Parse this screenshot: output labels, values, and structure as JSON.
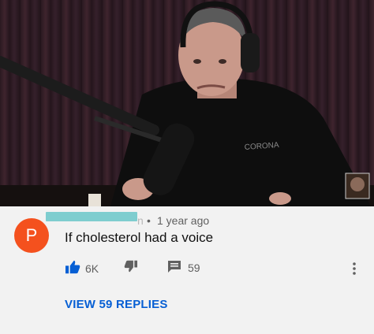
{
  "video": {
    "scene": "podcast-guest-at-microphone",
    "shirt_logo": "CORONA"
  },
  "comment": {
    "avatar_letter": "P",
    "username_tail": "n",
    "separator": "•",
    "timestamp": "1 year ago",
    "text": "If cholesterol had a voice",
    "likes": "6K",
    "replies_count": "59",
    "view_replies_label": "VIEW 59 REPLIES"
  },
  "colors": {
    "avatar": "#f4511e",
    "link_blue": "#065fd4",
    "redaction": "#7ecdcf"
  },
  "icons": [
    "thumbs-up-icon",
    "thumbs-down-icon",
    "reply-icon",
    "more-vertical-icon"
  ]
}
